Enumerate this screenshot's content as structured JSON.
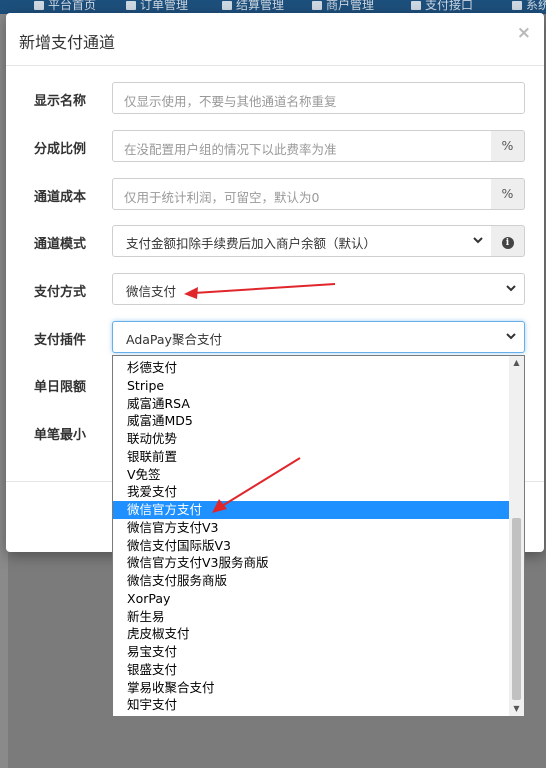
{
  "topnav": {
    "items": [
      {
        "label": "平台首页",
        "icon": "home-icon"
      },
      {
        "label": "订单管理",
        "icon": "list-icon"
      },
      {
        "label": "结算管理",
        "icon": "coins-icon"
      },
      {
        "label": "商户管理",
        "icon": "user-icon"
      },
      {
        "label": "支付接口",
        "icon": "card-icon"
      },
      {
        "label": "系统",
        "icon": "gear-icon"
      }
    ]
  },
  "modal": {
    "title": "新增支付通道",
    "close_label": "×",
    "fields": {
      "display_name": {
        "label": "显示名称",
        "placeholder": "仅显示使用，不要与其他通道名称重复"
      },
      "split_ratio": {
        "label": "分成比例",
        "placeholder": "在没配置用户组的情况下以此费率为准",
        "addon": "%"
      },
      "channel_cost": {
        "label": "通道成本",
        "placeholder": "仅用于统计利润，可留空，默认为0",
        "addon": "%"
      },
      "channel_mode": {
        "label": "通道模式",
        "value": "支付金额扣除手续费后加入商户余额（默认）",
        "info_icon": "info-icon"
      },
      "payment_method": {
        "label": "支付方式",
        "value": "微信支付"
      },
      "payment_plugin": {
        "label": "支付插件",
        "value": "AdaPay聚合支付"
      },
      "single_limit": {
        "label": "单日限额"
      },
      "single_min": {
        "label": "单笔最小"
      }
    }
  },
  "dropdown": {
    "selected_index": 8,
    "scroll_position_fraction": 0.85,
    "options": [
      "杉德支付",
      "Stripe",
      "威富通RSA",
      "威富通MD5",
      "联动优势",
      "银联前置",
      "V免签",
      "我爱支付",
      "微信官方支付",
      "微信官方支付V3",
      "微信支付国际版V3",
      "微信官方支付V3服务商版",
      "微信支付服务商版",
      "XorPay",
      "新生易",
      "虎皮椒支付",
      "易宝支付",
      "银盛支付",
      "掌易收聚合支付",
      "知宇支付"
    ]
  },
  "colors": {
    "nav_bg": "#1d4f7c",
    "selected_option": "#1e90ff",
    "focus_border": "#66afe9",
    "arrow": "#e0262b"
  }
}
